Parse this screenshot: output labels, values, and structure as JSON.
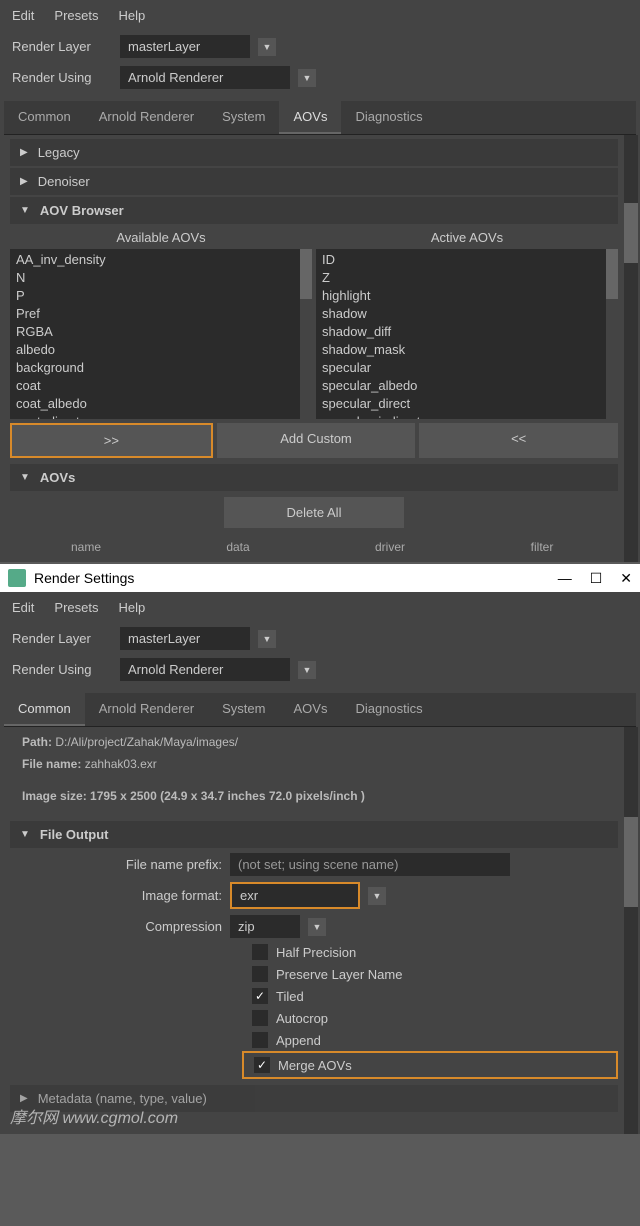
{
  "menubar": {
    "edit": "Edit",
    "presets": "Presets",
    "help": "Help"
  },
  "renderLayer": {
    "label": "Render Layer",
    "value": "masterLayer"
  },
  "renderUsing": {
    "label": "Render Using",
    "value": "Arnold Renderer"
  },
  "tabs": {
    "common": "Common",
    "arnold": "Arnold Renderer",
    "system": "System",
    "aovs": "AOVs",
    "diag": "Diagnostics"
  },
  "sections": {
    "legacy": "Legacy",
    "denoiser": "Denoiser",
    "aovBrowser": "AOV Browser",
    "aovs": "AOVs",
    "fileOutput": "File Output"
  },
  "aov": {
    "availTitle": "Available AOVs",
    "activeTitle": "Active AOVs",
    "available": [
      "AA_inv_density",
      "N",
      "P",
      "Pref",
      "RGBA",
      "albedo",
      "background",
      "coat",
      "coat_albedo",
      "coat_direct"
    ],
    "active": [
      "ID",
      "Z",
      "highlight",
      "shadow",
      "shadow_diff",
      "shadow_mask",
      "specular",
      "specular_albedo",
      "specular_direct",
      "specular_indirect"
    ]
  },
  "buttons": {
    "add": ">>",
    "addCustom": "Add Custom",
    "remove": "<<",
    "deleteAll": "Delete All"
  },
  "tableCols": {
    "name": "name",
    "data": "data",
    "driver": "driver",
    "filter": "filter"
  },
  "win": {
    "title": "Render Settings"
  },
  "info": {
    "pathLabel": "Path:",
    "path": "D:/Ali/project/Zahak/Maya/images/",
    "fileLabel": "File name:",
    "file": "zahhak03.exr",
    "sizeLabel": "Image size:",
    "size": "1795 x 2500 (24.9 x 34.7 inches 72.0 pixels/inch )"
  },
  "fileOutput": {
    "prefixLabel": "File name prefix:",
    "prefixValue": "(not set; using scene name)",
    "formatLabel": "Image format:",
    "formatValue": "exr",
    "compLabel": "Compression",
    "compValue": "zip",
    "halfPrecision": "Half Precision",
    "preserveLayer": "Preserve Layer Name",
    "tiled": "Tiled",
    "autocrop": "Autocrop",
    "append": "Append",
    "mergeAOVs": "Merge AOVs",
    "metadata": "Metadata (name, type, value)"
  },
  "watermark": "摩尔网 www.cgmol.com"
}
